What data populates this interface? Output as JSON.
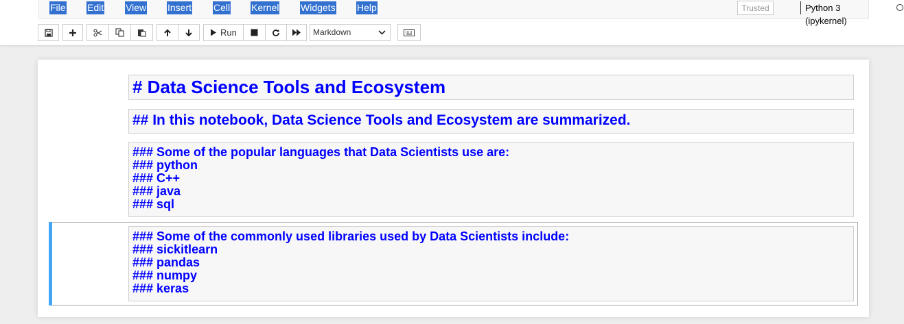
{
  "menu": {
    "items": [
      "File",
      "Edit",
      "View",
      "Insert",
      "Cell",
      "Kernel",
      "Widgets",
      "Help"
    ]
  },
  "status": {
    "trusted": "Trusted",
    "kernel": "Python 3 (ipykernel)"
  },
  "toolbar": {
    "run_label": "Run",
    "cell_type": "Markdown"
  },
  "cells": {
    "c1": [
      "# Data Science Tools and Ecosystem"
    ],
    "c2": [
      "## In this notebook, Data Science Tools and Ecosystem are summarized."
    ],
    "c3": [
      "### Some of the popular languages that Data Scientists use are:",
      "### python",
      "### C++",
      "### java",
      "### sql"
    ],
    "c4": [
      "### Some of the commonly used libraries used by Data Scientists include:",
      "### sickitlearn",
      "### pandas",
      "### numpy",
      "### keras"
    ]
  }
}
